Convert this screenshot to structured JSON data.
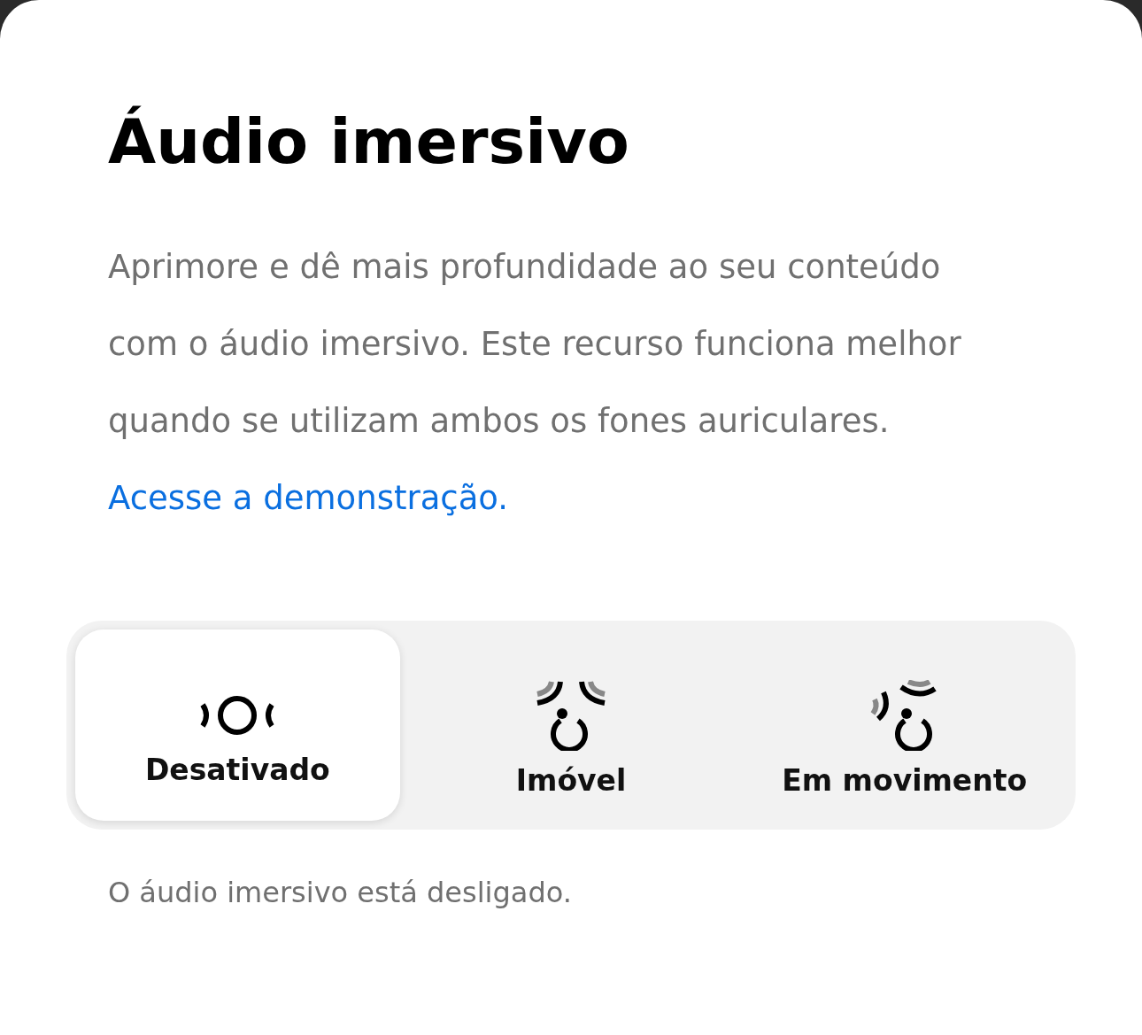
{
  "title": "Áudio imersivo",
  "description": "Aprimore e dê mais profundidade ao seu conteúdo com o áudio imersivo. Este recurso funciona melhor quando se utilizam ambos os fones auriculares.",
  "link": "Acesse a demonstração.",
  "options": [
    {
      "kind": "off",
      "label": "Desativado",
      "selected": true
    },
    {
      "kind": "static",
      "label": "Imóvel",
      "selected": false
    },
    {
      "kind": "moving",
      "label": "Em movimento",
      "selected": false
    }
  ],
  "status": "O áudio imersivo está desligado."
}
